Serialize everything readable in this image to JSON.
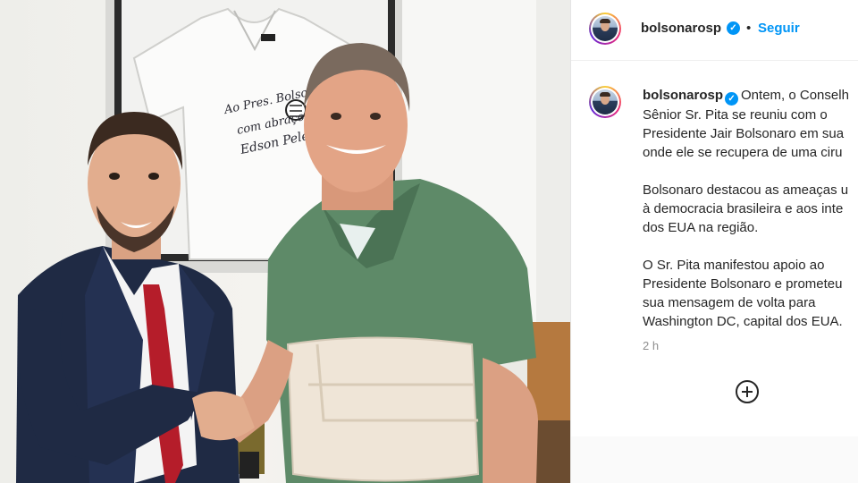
{
  "photo": {
    "shirt_signature": [
      "Ao Pres. Bolsonaro",
      "com abraço,",
      "Edson Pelé"
    ]
  },
  "post": {
    "header": {
      "username": "bolsonarosp",
      "verified_mark": "✓",
      "dot": "•",
      "follow_label": "Seguir"
    },
    "caption": {
      "username": "bolsonarosp",
      "verified_mark": "✓",
      "p1": [
        "Ontem, o Conselh",
        "Sênior Sr. Pita se reuniu com o",
        "Presidente Jair Bolsonaro em sua",
        "onde ele se recupera de uma ciru"
      ],
      "p2": [
        "Bolsonaro destacou as ameaças u",
        "à democracia brasileira e aos inte",
        "dos EUA na região."
      ],
      "p3": [
        "O Sr. Pita manifestou apoio ao",
        "Presidente Bolsonaro e prometeu",
        "sua mensagem de volta para",
        "Washington DC, capital dos EUA."
      ]
    },
    "timestamp": "2 h"
  },
  "colors": {
    "accent": "#0095f6",
    "text": "#262626",
    "muted": "#8e8e8e"
  },
  "icons": {
    "verified": "verified-badge-icon",
    "add_comment": "add-comment-icon"
  }
}
